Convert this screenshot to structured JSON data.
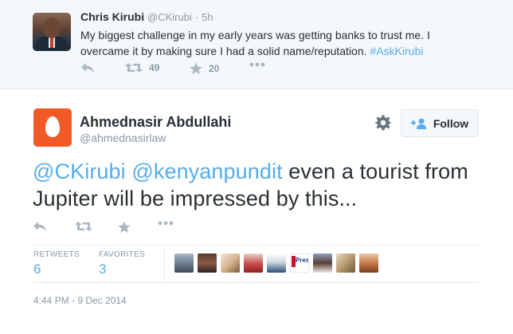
{
  "parent_tweet": {
    "name": "Chris Kirubi",
    "handle": "@CKirubi",
    "separator": "·",
    "time": "5h",
    "text_prefix": "My biggest challenge in my early years was getting banks to trust me. I overcame it by making sure I had a solid name/reputation. ",
    "hashtag": "#AskKirubi",
    "retweets": "49",
    "favorites": "20"
  },
  "main_tweet": {
    "name": "Ahmednasir Abdullahi",
    "handle": "@ahmednasirlaw",
    "follow_label": "Follow",
    "mention1": "@CKirubi",
    "mention2": "@kenyanpundit",
    "text_rest": " even a tourist from Jupiter will be impressed by this...",
    "stats": {
      "retweets_label": "RETWEETS",
      "retweets_value": "6",
      "favorites_label": "FAVORITES",
      "favorites_value": "3"
    },
    "favoriters_pres_text": "Pres",
    "timestamp": "4:44 PM - 9 Dec 2014"
  },
  "icons": [
    "reply-icon",
    "retweet-icon",
    "favorite-icon",
    "more-icon",
    "gear-icon",
    "follow-person-icon"
  ],
  "colors": {
    "link": "#55acee",
    "muted": "#8899a6",
    "icon": "#aab8c2",
    "avatar_bg": "#f15a24"
  }
}
